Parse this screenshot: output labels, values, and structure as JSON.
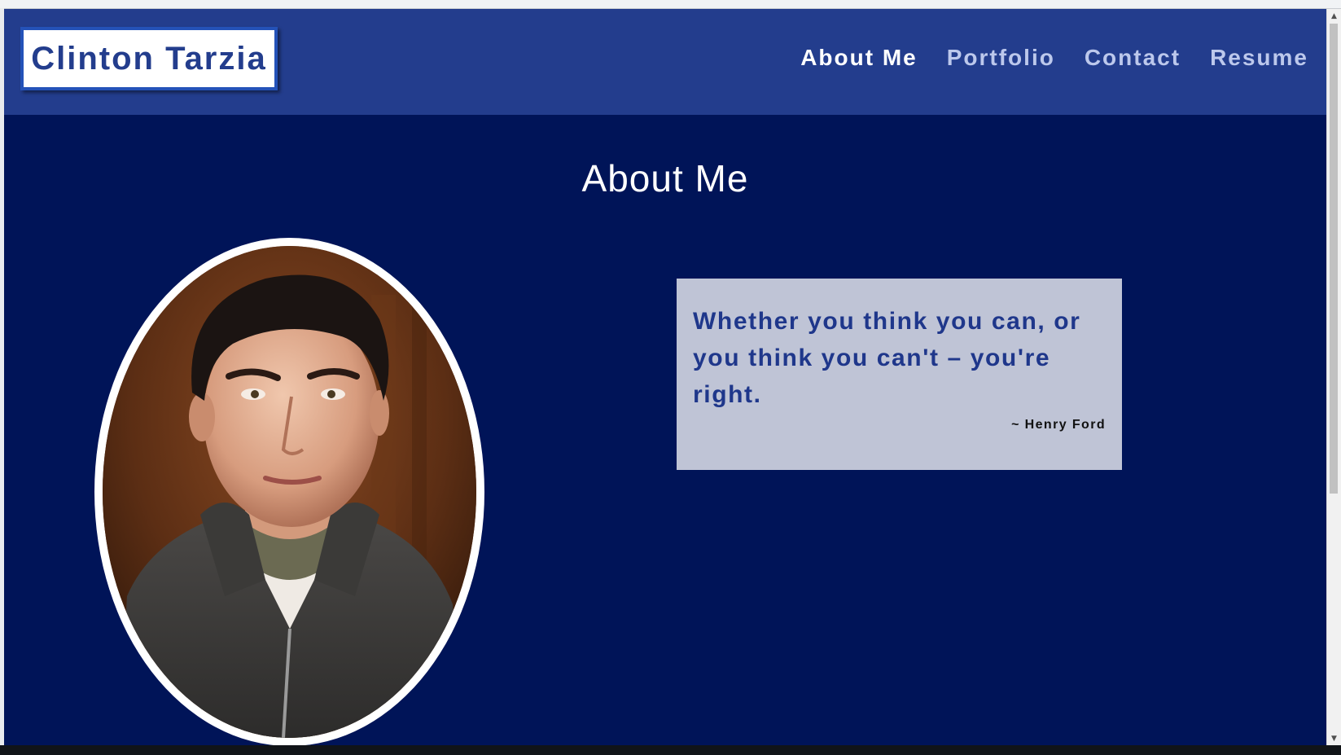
{
  "header": {
    "logo_text": "Clinton Tarzia",
    "nav": [
      {
        "label": "About Me",
        "active": true
      },
      {
        "label": "Portfolio",
        "active": false
      },
      {
        "label": "Contact",
        "active": false
      },
      {
        "label": "Resume",
        "active": false
      }
    ]
  },
  "main": {
    "heading": "About Me",
    "quote": {
      "text": "Whether you think you can, or you think you can't – you're right.",
      "author": "~ Henry Ford"
    }
  },
  "colors": {
    "page_background": "#001458",
    "header_background": "#233d8d",
    "nav_active": "#ffffff",
    "nav_inactive": "#bcc8ec",
    "quote_background": "#bfc4d6",
    "quote_text": "#1f378b"
  },
  "icons": {
    "scroll_up": "scroll-up-arrow-icon",
    "scroll_down": "scroll-down-arrow-icon"
  }
}
